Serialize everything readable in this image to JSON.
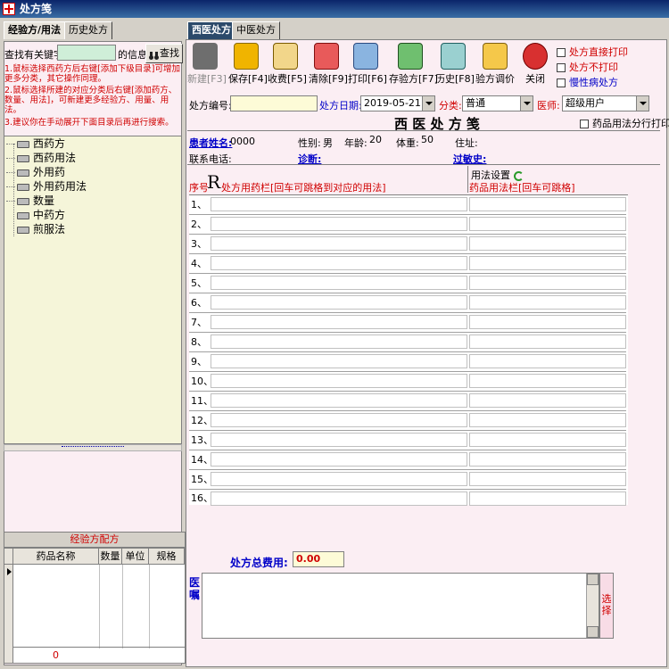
{
  "window": {
    "title": "处方笺"
  },
  "left_tabs": [
    "经验方/用法",
    "历史处方"
  ],
  "search": {
    "label": "查找有关键字",
    "suffix": "的信息",
    "button": "查找"
  },
  "hints": [
    "1.鼠标选择西药方后右键[添加下级目录]可增加更多分类，其它操作同理。",
    "2.鼠标选择所建的对应分类后右键[添加药方、数量、用法]，可新建更多经验方、用量、用法。",
    "3.建议你在手动展开下面目录后再进行搜索。"
  ],
  "tree": [
    "西药方",
    "西药用法",
    "外用药",
    "外用药用法",
    "数量",
    "中药方",
    "煎服法"
  ],
  "experience_panel": {
    "title": "经验方配方",
    "columns": [
      "药品名称",
      "数量",
      "单位",
      "规格"
    ],
    "footer_value": "0"
  },
  "right_tabs": [
    "西医处方",
    "中医处方"
  ],
  "toolbar": [
    {
      "label": "新建[F3]",
      "icon": "new-icon",
      "enabled": false
    },
    {
      "label": "保存[F4]",
      "icon": "save-icon",
      "enabled": true
    },
    {
      "label": "收费[F5]",
      "icon": "charge-icon",
      "enabled": true
    },
    {
      "label": "清除[F9]",
      "icon": "clear-icon",
      "enabled": true
    },
    {
      "label": "打印[F6]",
      "icon": "print-icon",
      "enabled": true
    },
    {
      "label": "存验方[F7]",
      "icon": "save-recipe-icon",
      "enabled": true
    },
    {
      "label": "历史[F8]",
      "icon": "history-icon",
      "enabled": true
    },
    {
      "label": "验方调价",
      "icon": "price-adjust-icon",
      "enabled": true
    },
    {
      "label": "关闭",
      "icon": "close-icon",
      "enabled": true
    }
  ],
  "options": [
    "处方直接打印",
    "处方不打印",
    "慢性病处方"
  ],
  "form": {
    "rx_number_label": "处方编号:",
    "rx_date_label": "处方日期:",
    "rx_date": "2019-05-21",
    "category_label": "分类:",
    "category": "普通",
    "doctor_label": "医师:",
    "doctor": "超级用户",
    "heading": "西 医 处 方 笺",
    "print_usage_option": "药品用法分行打印",
    "patient_label": "患者姓名:",
    "patient_id": "0000",
    "gender_label": "性别:",
    "gender": "男",
    "age_label": "年龄:",
    "age": "20",
    "weight_label": "体重:",
    "weight": "50",
    "address_label": "住址:",
    "phone_label": "联系电话:",
    "diagnosis_label": "诊断:",
    "allergy_label": "过敏史:"
  },
  "rx_table": {
    "seq_label": "序号",
    "rx_symbol": "R",
    "drug_col": "处方用药栏[回车可跳格到对应的用法]",
    "usage_settings": "用法设置",
    "usage_col": "药品用法栏[回车可跳格]",
    "rows": [
      "1、",
      "2、",
      "3、",
      "4、",
      "5、",
      "6、",
      "7、",
      "8、",
      "9、",
      "10、",
      "11、",
      "12、",
      "13、",
      "14、",
      "15、",
      "16、"
    ]
  },
  "total": {
    "label": "处方总费用:",
    "value": "0.00"
  },
  "advice": {
    "label": "医嘱",
    "select_button": "选择"
  },
  "colors": {
    "accent_red": "#d00000",
    "link_blue": "#0000c8",
    "pink_bg": "#fbeef3",
    "tree_bg": "#f5f5d9"
  }
}
